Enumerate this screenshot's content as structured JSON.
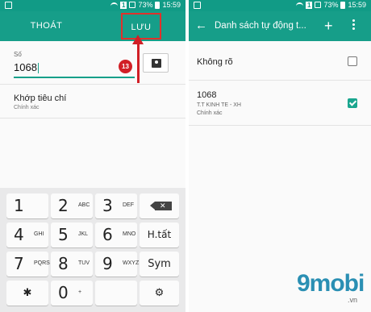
{
  "left_screen": {
    "status": {
      "battery": "73%",
      "time": "15:59",
      "sim": "1"
    },
    "appbar": {
      "exit_label": "THOÁT",
      "save_label": "LƯU"
    },
    "number_field": {
      "label": "Số",
      "value": "1068"
    },
    "annotation_badge": "13",
    "match_row": {
      "title": "Khớp tiêu chí",
      "subtitle": "Chính xác"
    },
    "keypad": {
      "keys": [
        {
          "digit": "1",
          "letters": ""
        },
        {
          "digit": "2",
          "letters": "ABC"
        },
        {
          "digit": "3",
          "letters": "DEF"
        },
        {
          "digit": "4",
          "letters": "GHI"
        },
        {
          "digit": "5",
          "letters": "JKL"
        },
        {
          "digit": "6",
          "letters": "MNO"
        },
        {
          "digit": "7",
          "letters": "PQRS"
        },
        {
          "digit": "8",
          "letters": "TUV"
        },
        {
          "digit": "9",
          "letters": "WXYZ"
        },
        {
          "digit": "✱",
          "letters": ""
        },
        {
          "digit": "0",
          "letters": "+"
        },
        {
          "digit": "⚙",
          "letters": ""
        }
      ],
      "htat_label": "H.tất",
      "sym_label": "Sym"
    }
  },
  "right_screen": {
    "status": {
      "battery": "73%",
      "time": "15:59",
      "sim": "1"
    },
    "appbar": {
      "back_glyph": "←",
      "title": "Danh sách tự động t...",
      "add_glyph": "+"
    },
    "rows": [
      {
        "title": "Không rõ",
        "line1": "",
        "line2": "",
        "checked": false
      },
      {
        "title": "1068",
        "line1": "T.T KINH TE - XH",
        "line2": "Chính xác",
        "checked": true
      }
    ]
  },
  "watermark": {
    "logo": "9mobi",
    "domain": ".vn"
  },
  "colors": {
    "teal": "#169e89",
    "status_bar": "#119b86",
    "annotation_red": "#d11f26"
  }
}
